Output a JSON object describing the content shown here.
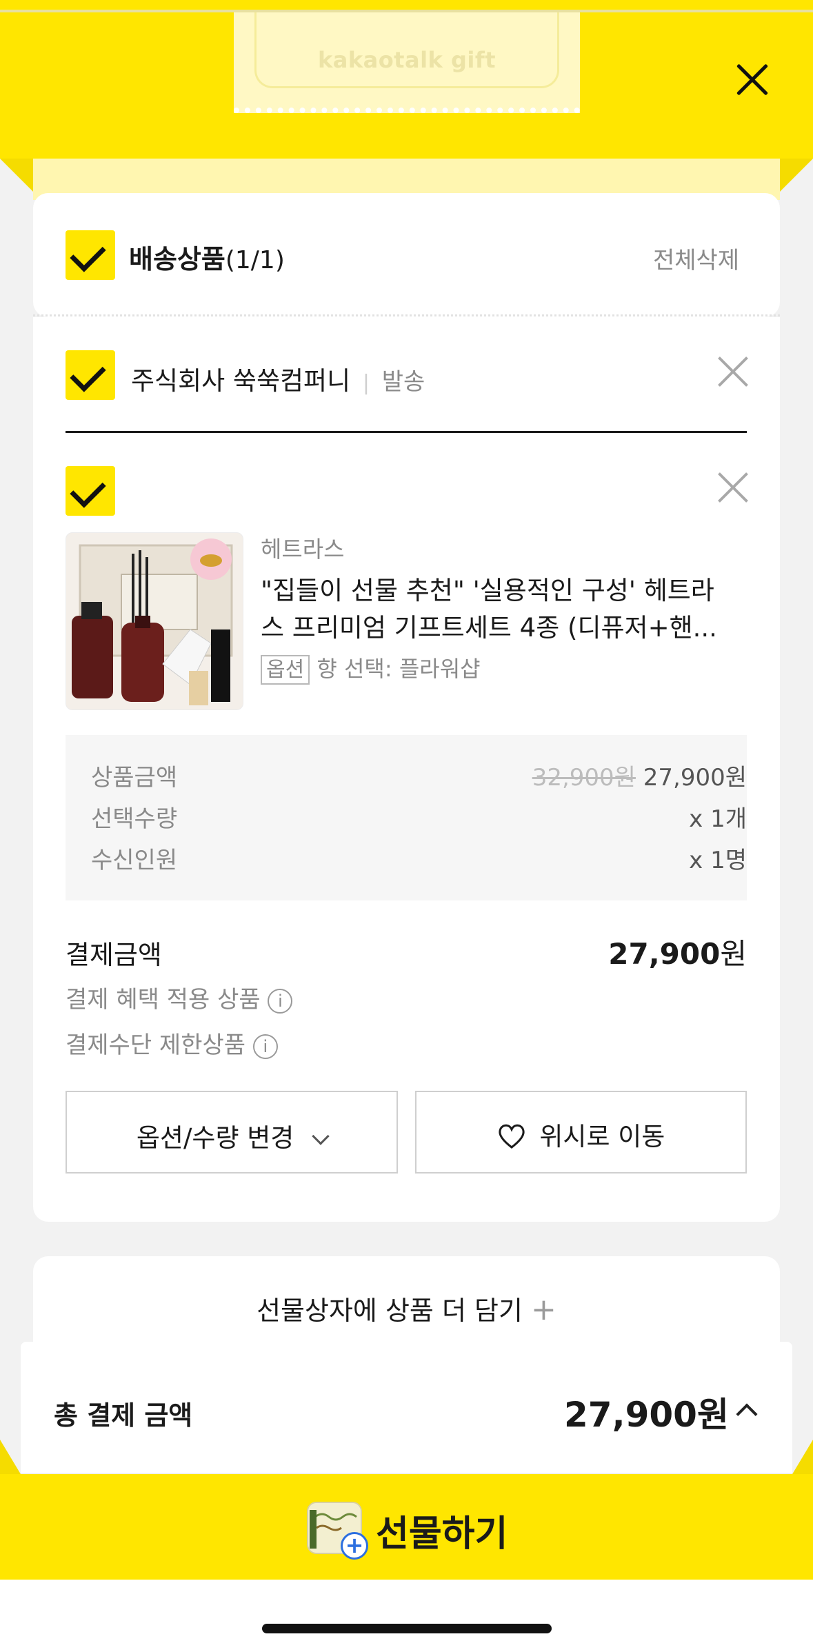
{
  "header": {
    "logo_text": "kakaotalk gift"
  },
  "section": {
    "title": "배송상품",
    "count": "(1/1)",
    "delete_all": "전체삭제"
  },
  "seller": {
    "name": "주식회사 쑥쑥컴퍼니",
    "separator": "|",
    "shipping": "발송"
  },
  "product": {
    "brand": "헤트라스",
    "name_line1": "\"집들이 선물 추천\" '실용적인 구성' 헤트라",
    "name_line2": "스 프리미엄 기프트세트 4종 (디퓨저+핸...",
    "option_badge": "옵션",
    "option_text": "향 선택: 플라워샵"
  },
  "price_details": {
    "rows": [
      {
        "label": "상품금액",
        "original": "32,900원",
        "value": "27,900원"
      },
      {
        "label": "선택수량",
        "value": "x 1개"
      },
      {
        "label": "수신인원",
        "value": "x 1명"
      }
    ]
  },
  "payment": {
    "label": "결제금액",
    "amount": "27,900",
    "unit": "원",
    "benefit_text": "결제 혜택 적용 상품",
    "restriction_text": "결제수단 제한상품"
  },
  "buttons": {
    "change_option": "옵션/수량 변경",
    "move_wishlist": "위시로 이동",
    "add_more": "선물상자에 상품 더 담기",
    "add_more_plus": "+"
  },
  "total": {
    "label": "총 결제 금액",
    "amount": "27,900원"
  },
  "gift_button": {
    "label": "선물하기"
  },
  "colors": {
    "brand_yellow": "#ffe600",
    "text_primary": "#1a1a1a",
    "text_secondary": "#888888"
  }
}
